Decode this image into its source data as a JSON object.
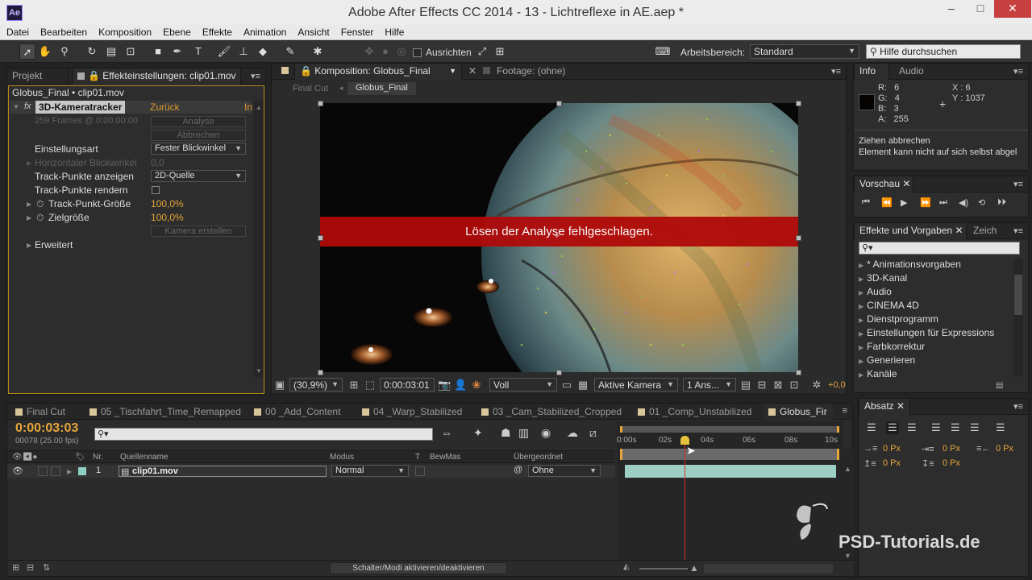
{
  "window": {
    "title": "Adobe After Effects CC 2014 - 13 - Lichtreflexe in AE.aep *",
    "app_icon": "Ae"
  },
  "menu": [
    "Datei",
    "Bearbeiten",
    "Komposition",
    "Ebene",
    "Effekte",
    "Animation",
    "Ansicht",
    "Fenster",
    "Hilfe"
  ],
  "toolbar": {
    "align_label": "Ausrichten",
    "workspace_label": "Arbeitsbereich:",
    "workspace_value": "Standard",
    "search_placeholder": "Hilfe durchsuchen"
  },
  "effect_panel": {
    "tab_project": "Projekt",
    "tab_effects": "Effekteinstellungen: clip01.mov",
    "breadcrumb": "Globus_Final • clip01.mov",
    "effect_name": "3D-Kameratracker",
    "reset": "Zurück",
    "info": "In",
    "frames": "259 Frames @ 0:00:00:00",
    "btn_analyze": "Analyse",
    "btn_cancel": "Abbrechen",
    "settings_label": "Einstellungsart",
    "settings_value": "Fester Blickwinkel",
    "hfov_label": "Horizontaler Blickwinkel",
    "hfov_value": "0,0",
    "show_points_label": "Track-Punkte anzeigen",
    "show_points_value": "2D-Quelle",
    "render_points_label": "Track-Punkte rendern",
    "point_size_label": "Track-Punkt-Größe",
    "point_size_value": "100,0%",
    "target_size_label": "Zielgröße",
    "target_size_value": "100,0%",
    "btn_create_camera": "Kamera erstellen",
    "advanced_label": "Erweitert"
  },
  "composition": {
    "tab_comp": "Komposition: Globus_Final",
    "tab_footage": "Footage: (ohne)",
    "crumb_final_cut": "Final Cut",
    "crumb_globus": "Globus_Final",
    "banner_text": "Lösen der Analyse fehlgeschlagen.",
    "zoom": "(30,9%)",
    "timecode": "0:00:03:01",
    "resolution": "Voll",
    "camera": "Aktive Kamera",
    "views": "1 Ans...",
    "exposure": "+0,0"
  },
  "info_panel": {
    "tab_info": "Info",
    "tab_audio": "Audio",
    "r_label": "R:",
    "r": "6",
    "g_label": "G:",
    "g": "4",
    "b_label": "B:",
    "b": "3",
    "a_label": "A:",
    "a": "255",
    "x_label": "X :",
    "x": "6",
    "y_label": "Y :",
    "y": "1037",
    "msg1": "Ziehen abbrechen",
    "msg2": "Element kann nicht auf sich selbst abgel"
  },
  "preview_panel": {
    "tab": "Vorschau"
  },
  "effects_presets": {
    "tab": "Effekte und Vorgaben",
    "tab2": "Zeich",
    "items": [
      "* Animationsvorgaben",
      "3D-Kanal",
      "Audio",
      "CINEMA 4D",
      "Dienstprogramm",
      "Einstellungen für Expressions",
      "Farbkorrektur",
      "Generieren",
      "Kanäle"
    ]
  },
  "timeline": {
    "tabs": [
      "Final Cut",
      "05 _Tischfahrt_Time_Remapped",
      "00 _Add_Content",
      "04 _Warp_Stabilized",
      "03 _Cam_Stabilized_Cropped",
      "01 _Comp_Unstabilized",
      "Globus_Fir"
    ],
    "timecode": "0:00:03:03",
    "frames_fps": "00078 (25.00 fps)",
    "col_nr": "Nr.",
    "col_source": "Quellenname",
    "col_mode": "Modus",
    "col_t": "T",
    "col_trkmat": "BewMas",
    "col_parent": "Übergeordnet",
    "layer_num": "1",
    "layer_name": "clip01.mov",
    "layer_mode": "Normal",
    "layer_parent": "Ohne",
    "ruler": [
      "0:00s",
      "02s",
      "04s",
      "06s",
      "08s",
      "10s"
    ],
    "toggle_btn": "Schalter/Modi aktivieren/deaktivieren"
  },
  "paragraph_panel": {
    "tab": "Absatz",
    "indent1": "0 Px",
    "indent2": "0 Px",
    "indent3": "0 Px",
    "space1": "0 Px",
    "space2": "0 Px"
  },
  "watermark": "PSD-Tutorials.de"
}
